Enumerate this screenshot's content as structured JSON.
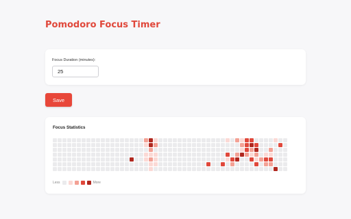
{
  "app": {
    "title": "Pomodoro Focus Timer"
  },
  "settings": {
    "duration_label": "Focus Duration (minutes):",
    "duration_value": "25",
    "save_label": "Save"
  },
  "stats": {
    "title": "Focus Statistics",
    "legend_less": "Less",
    "legend_more": "More",
    "level_colors": [
      "#ebebed",
      "#fbd9d5",
      "#f3a195",
      "#e0483b",
      "#b0281f",
      "#8a1d17"
    ],
    "weeks": 49,
    "days_per_week": 7,
    "activity": [
      [
        19,
        0,
        2
      ],
      [
        19,
        1,
        1
      ],
      [
        19,
        3,
        1
      ],
      [
        19,
        4,
        1
      ],
      [
        20,
        0,
        4
      ],
      [
        20,
        1,
        4
      ],
      [
        20,
        2,
        2
      ],
      [
        20,
        3,
        1
      ],
      [
        20,
        4,
        2
      ],
      [
        20,
        5,
        1
      ],
      [
        20,
        6,
        1
      ],
      [
        21,
        0,
        1
      ],
      [
        21,
        1,
        2
      ],
      [
        21,
        3,
        1
      ],
      [
        21,
        4,
        1
      ],
      [
        21,
        5,
        1
      ],
      [
        16,
        4,
        4
      ],
      [
        36,
        0,
        1
      ],
      [
        38,
        0,
        2
      ],
      [
        39,
        0,
        1
      ],
      [
        40,
        0,
        3
      ],
      [
        41,
        0,
        3
      ],
      [
        46,
        0,
        1
      ],
      [
        39,
        1,
        2
      ],
      [
        40,
        1,
        3
      ],
      [
        41,
        1,
        4
      ],
      [
        42,
        1,
        3
      ],
      [
        47,
        1,
        3
      ],
      [
        39,
        2,
        1
      ],
      [
        40,
        2,
        3
      ],
      [
        41,
        2,
        2
      ],
      [
        42,
        2,
        4
      ],
      [
        45,
        2,
        2
      ],
      [
        36,
        3,
        3
      ],
      [
        38,
        3,
        2
      ],
      [
        39,
        3,
        4
      ],
      [
        40,
        3,
        2
      ],
      [
        41,
        3,
        1
      ],
      [
        42,
        3,
        2
      ],
      [
        44,
        3,
        1
      ],
      [
        45,
        3,
        1
      ],
      [
        36,
        4,
        1
      ],
      [
        37,
        4,
        3
      ],
      [
        38,
        4,
        4
      ],
      [
        41,
        4,
        3
      ],
      [
        42,
        4,
        1
      ],
      [
        43,
        4,
        2
      ],
      [
        44,
        4,
        3
      ],
      [
        45,
        4,
        3
      ],
      [
        32,
        5,
        3
      ],
      [
        35,
        5,
        3
      ],
      [
        37,
        5,
        2
      ],
      [
        42,
        5,
        3
      ],
      [
        44,
        5,
        2
      ],
      [
        45,
        5,
        2
      ],
      [
        46,
        6,
        4
      ]
    ]
  }
}
